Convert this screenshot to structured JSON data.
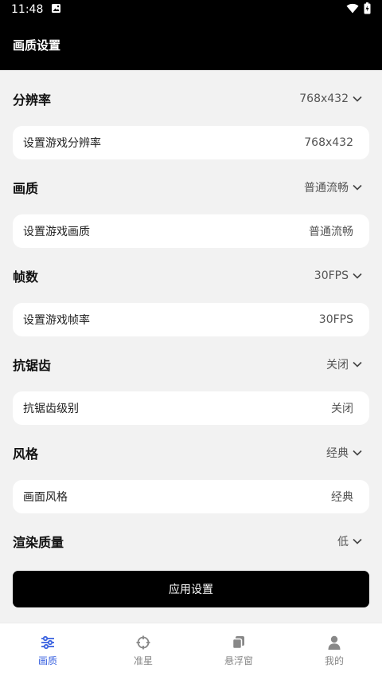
{
  "status_bar": {
    "time": "11:48"
  },
  "top_bar": {
    "title": "画质设置"
  },
  "sections": [
    {
      "title": "分辨率",
      "value": "768x432",
      "card_label": "设置游戏分辨率",
      "card_value": "768x432"
    },
    {
      "title": "画质",
      "value": "普通流畅",
      "card_label": "设置游戏画质",
      "card_value": "普通流畅"
    },
    {
      "title": "帧数",
      "value": "30FPS",
      "card_label": "设置游戏帧率",
      "card_value": "30FPS"
    },
    {
      "title": "抗锯齿",
      "value": "关闭",
      "card_label": "抗锯齿级别",
      "card_value": "关闭"
    },
    {
      "title": "风格",
      "value": "经典",
      "card_label": "画面风格",
      "card_value": "经典"
    },
    {
      "title": "渲染质量",
      "value": "低"
    }
  ],
  "apply_button": {
    "label": "应用设置"
  },
  "bottom_nav": {
    "items": [
      {
        "label": "画质",
        "icon": "sliders-icon",
        "active": true
      },
      {
        "label": "准星",
        "icon": "crosshair-icon",
        "active": false
      },
      {
        "label": "悬浮窗",
        "icon": "floating-window-icon",
        "active": false
      },
      {
        "label": "我的",
        "icon": "person-icon",
        "active": false
      }
    ]
  },
  "colors": {
    "accent": "#3b63e0",
    "header_bg": "#000000",
    "page_bg": "#f2f2f2"
  }
}
